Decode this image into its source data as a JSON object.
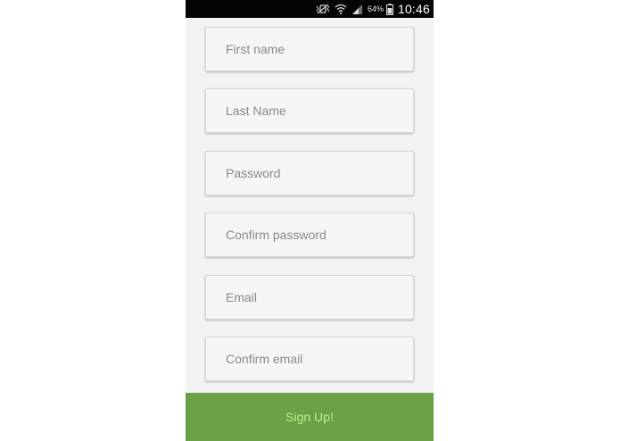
{
  "status_bar": {
    "battery_percent": "64%",
    "time": "10:46",
    "icons": [
      "mute-vibrate-icon",
      "wifi-icon",
      "signal-icon",
      "battery-icon"
    ]
  },
  "form": {
    "fields": [
      {
        "placeholder": "First name",
        "value": ""
      },
      {
        "placeholder": "Last Name",
        "value": ""
      },
      {
        "placeholder": "Password",
        "value": ""
      },
      {
        "placeholder": "Confirm password",
        "value": ""
      },
      {
        "placeholder": "Email",
        "value": ""
      },
      {
        "placeholder": "Confirm email",
        "value": ""
      }
    ]
  },
  "signup_button": {
    "label": "Sign Up!"
  },
  "colors": {
    "status_bar_bg": "#050505",
    "screen_bg": "#f2f2f2",
    "field_bg": "#f5f5f5",
    "button_bg": "#6aa046",
    "button_text": "#b6f08a"
  }
}
